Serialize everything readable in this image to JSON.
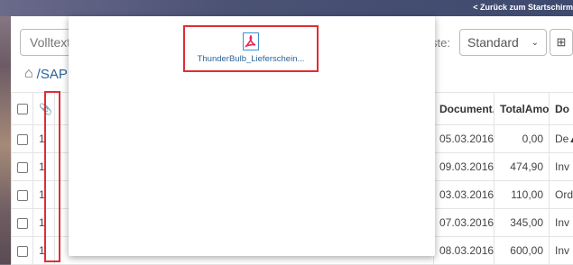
{
  "topbar": {
    "back_label": "< Zurück zum Startschirm"
  },
  "search": {
    "placeholder": "Volltextsuche"
  },
  "toolbar": {
    "list_label": "ste:",
    "list_value": "Standard",
    "grid_icon": "grid-icon",
    "help_icon": "help-icon"
  },
  "breadcrumb": {
    "path": "/SAP"
  },
  "table": {
    "headers": {
      "document": "Document...",
      "total": "TotalAmo...",
      "do": "Do"
    },
    "rows": [
      {
        "clip": "1",
        "date": "05.03.2016",
        "amount": "0,00",
        "do": "De"
      },
      {
        "clip": "1",
        "date": "09.03.2016",
        "amount": "474,90",
        "do": "Inv"
      },
      {
        "clip": "1",
        "date": "03.03.2016",
        "amount": "110,00",
        "do": "Ord"
      },
      {
        "clip": "1",
        "date": "07.03.2016",
        "amount": "345,00",
        "do": "Inv"
      },
      {
        "clip": "1",
        "date": "08.03.2016",
        "amount": "600,00",
        "do": "Inv"
      }
    ]
  },
  "popup": {
    "file_name": "ThunderBulb_Lieferschein..."
  },
  "colors": {
    "accent": "#2a6496",
    "highlight": "#e02d33",
    "pdf_red": "#e8265a"
  }
}
